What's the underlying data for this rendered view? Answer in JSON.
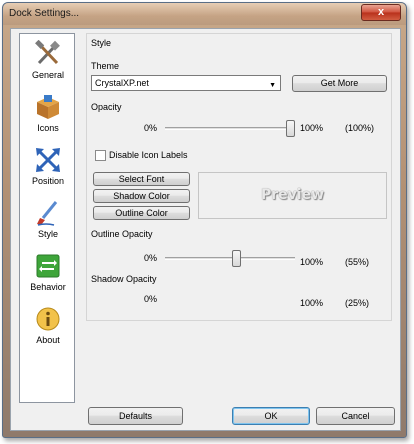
{
  "window": {
    "title": "Dock Settings...",
    "close_label": "x"
  },
  "sidebar": {
    "items": [
      {
        "label": "General",
        "icon": "tools-icon"
      },
      {
        "label": "Icons",
        "icon": "box-icon"
      },
      {
        "label": "Position",
        "icon": "arrows-icon"
      },
      {
        "label": "Style",
        "icon": "paintbrush-icon"
      },
      {
        "label": "Behavior",
        "icon": "behavior-icon"
      },
      {
        "label": "About",
        "icon": "info-icon"
      }
    ]
  },
  "style_group": {
    "title": "Style",
    "theme_label": "Theme",
    "theme_value": "CrystalXP.net",
    "get_more_label": "Get More",
    "opacity": {
      "label": "Opacity",
      "min": "0%",
      "max": "100%",
      "current": "(100%)",
      "value": 100
    },
    "disable_labels": {
      "label": "Disable Icon Labels",
      "checked": false
    },
    "select_font_label": "Select Font",
    "shadow_color_label": "Shadow Color",
    "outline_color_label": "Outline Color",
    "preview_label": "Preview",
    "outline_opacity": {
      "label": "Outline Opacity",
      "min": "0%",
      "max": "100%",
      "current": "(55%)",
      "value": 55
    },
    "shadow_opacity": {
      "label": "Shadow Opacity",
      "min": "0%",
      "max": "100%",
      "current": "(25%)",
      "value": 25
    }
  },
  "footer": {
    "defaults_label": "Defaults",
    "ok_label": "OK",
    "cancel_label": "Cancel"
  }
}
